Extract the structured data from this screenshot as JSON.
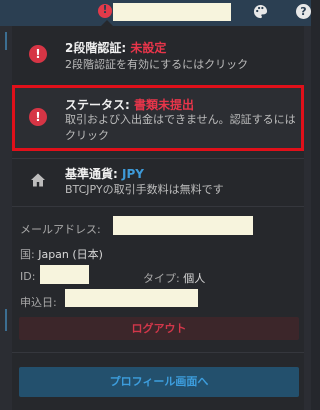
{
  "user_menu": {
    "items": [
      {
        "title": "2段階認証:",
        "status": "未設定",
        "description": "2段階認証を有効にするにはクリック"
      },
      {
        "title": "ステータス:",
        "status": "書類未提出",
        "description": "取引および入出金はできません。認証するにはクリック"
      },
      {
        "title": "基準通貨:",
        "status": "JPY",
        "description": "BTCJPYの取引手数料は無料です"
      }
    ],
    "info": {
      "email_label": "メールアドレス:",
      "country_label": "国:",
      "country_value": "Japan (日本)",
      "id_label": "ID:",
      "type_label": "タイプ:",
      "type_value": "個人",
      "applied_label": "申込日:"
    },
    "logout_label": "ログアウト",
    "profile_label": "プロフィール画面へ"
  },
  "colors": {
    "alert_red": "#e8354a",
    "accent_blue": "#3e9ad8",
    "highlight_border": "#e0101a"
  }
}
